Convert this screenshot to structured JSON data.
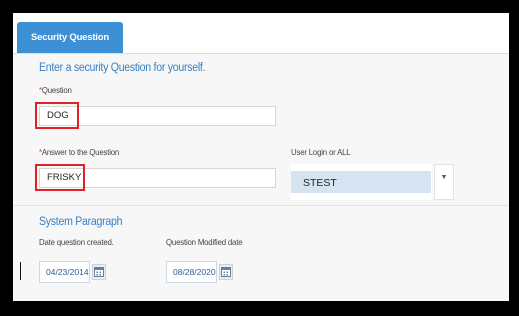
{
  "tabs": [
    {
      "label": "Security Question"
    }
  ],
  "main": {
    "heading": "Enter a security Question for yourself.",
    "question": {
      "required_marker": "*",
      "label": "Question",
      "value": "DOG"
    },
    "answer": {
      "required_marker": "*",
      "label": "Answer to the Question",
      "value": "FRISKY"
    },
    "user_login": {
      "label": "User Login or ALL",
      "selected": "STEST"
    }
  },
  "system": {
    "heading": "System Paragraph",
    "created": {
      "label": "Date question created.",
      "value": "04/23/2014"
    },
    "modified": {
      "label": "Question Modified date",
      "value": "08/28/2020"
    }
  },
  "colors": {
    "accent": "#3d8fd6",
    "heading": "#3a7fc1",
    "highlight_border": "#e0202a",
    "select_fill": "#d6e3f0"
  },
  "icons": {
    "calendar": "calendar-icon",
    "dropdown": "chevron-down-icon"
  }
}
